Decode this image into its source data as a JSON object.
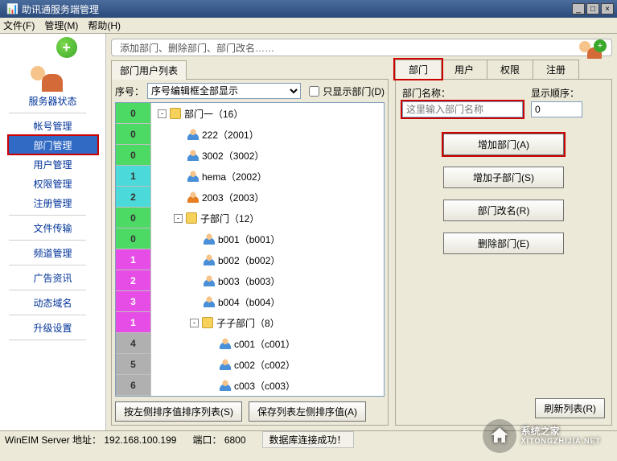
{
  "window": {
    "title": "助讯通服务端管理"
  },
  "menubar": {
    "file": "文件(F)",
    "manage": "管理(M)",
    "help": "帮助(H)"
  },
  "sidebar": {
    "items": [
      {
        "label": "服务器状态"
      },
      {
        "label": "帐号管理"
      },
      {
        "label": "部门管理"
      },
      {
        "label": "用户管理"
      },
      {
        "label": "权限管理"
      },
      {
        "label": "注册管理"
      },
      {
        "label": "文件传输"
      },
      {
        "label": "频道管理"
      },
      {
        "label": "广告资讯"
      },
      {
        "label": "动态域名"
      },
      {
        "label": "升级设置"
      }
    ],
    "selected_index": 2
  },
  "banner": {
    "text": "添加部门、删除部门、部门改名……"
  },
  "left": {
    "tab": "部门用户列表",
    "seq_label": "序号：",
    "seq_select": "序号编辑框全部显示",
    "only_dept_label": "只显示部门(D)",
    "only_dept_checked": false,
    "numcol": [
      {
        "v": "0",
        "c": "c-green"
      },
      {
        "v": "0",
        "c": "c-green"
      },
      {
        "v": "0",
        "c": "c-green"
      },
      {
        "v": "1",
        "c": "c-cyan"
      },
      {
        "v": "2",
        "c": "c-cyan"
      },
      {
        "v": "0",
        "c": "c-green"
      },
      {
        "v": "0",
        "c": "c-green"
      },
      {
        "v": "1",
        "c": "c-magenta"
      },
      {
        "v": "2",
        "c": "c-magenta"
      },
      {
        "v": "3",
        "c": "c-magenta"
      },
      {
        "v": "1",
        "c": "c-magenta"
      },
      {
        "v": "4",
        "c": "c-gray"
      },
      {
        "v": "5",
        "c": "c-gray"
      },
      {
        "v": "6",
        "c": "c-gray"
      }
    ],
    "tree": [
      {
        "indent": 0,
        "toggle": "-",
        "icon": "folder",
        "label": "部门一（16）"
      },
      {
        "indent": 1,
        "toggle": "",
        "icon": "user",
        "label": "222（2001）"
      },
      {
        "indent": 1,
        "toggle": "",
        "icon": "user",
        "label": "3002（3002）"
      },
      {
        "indent": 1,
        "toggle": "",
        "icon": "user",
        "label": "hema（2002）"
      },
      {
        "indent": 1,
        "toggle": "",
        "icon": "user2",
        "label": "2003（2003）"
      },
      {
        "indent": 1,
        "toggle": "-",
        "icon": "folder",
        "label": "子部门（12）"
      },
      {
        "indent": 2,
        "toggle": "",
        "icon": "user",
        "label": "b001（b001）"
      },
      {
        "indent": 2,
        "toggle": "",
        "icon": "user",
        "label": "b002（b002）"
      },
      {
        "indent": 2,
        "toggle": "",
        "icon": "user",
        "label": "b003（b003）"
      },
      {
        "indent": 2,
        "toggle": "",
        "icon": "user",
        "label": "b004（b004）"
      },
      {
        "indent": 2,
        "toggle": "-",
        "icon": "folder",
        "label": "子子部门（8）"
      },
      {
        "indent": 3,
        "toggle": "",
        "icon": "user",
        "label": "c001（c001）"
      },
      {
        "indent": 3,
        "toggle": "",
        "icon": "user",
        "label": "c002（c002）"
      },
      {
        "indent": 3,
        "toggle": "",
        "icon": "user",
        "label": "c003（c003）"
      }
    ],
    "btn_sort": "按左侧排序值排序列表(S)",
    "btn_save": "保存列表左侧排序值(A)"
  },
  "right": {
    "tabs": {
      "dept": "部门",
      "user": "用户",
      "perm": "权限",
      "reg": "注册"
    },
    "form": {
      "dept_label": "部门名称：",
      "dept_placeholder": "这里输入部门名称",
      "dept_value": "",
      "order_label": "显示顺序：",
      "order_value": "0"
    },
    "buttons": {
      "add": "增加部门(A)",
      "addsub": "增加子部门(S)",
      "rename": "部门改名(R)",
      "delete": "删除部门(E)",
      "refresh": "刷新列表(R)"
    }
  },
  "status": {
    "addr_label": "WinEIM Server 地址：",
    "addr": "192.168.100.199",
    "port_label": "端口：",
    "port": "6800",
    "db": "数据库连接成功！"
  },
  "watermark": {
    "text": "系统之家",
    "url": "XITONGZHIJIA.NET"
  }
}
